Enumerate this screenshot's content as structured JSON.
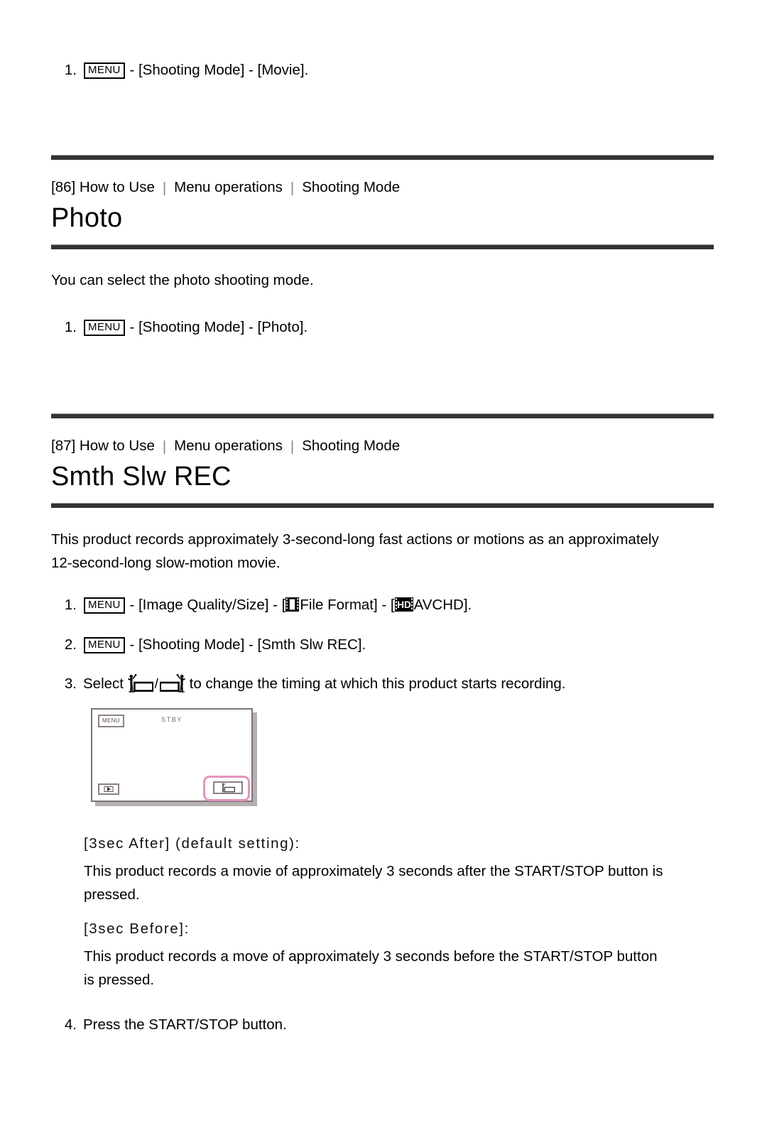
{
  "document": {
    "title": "Smth Slw REC"
  },
  "section_movie_step": {
    "number": "1.",
    "menu_label": "MENU",
    "text": " - [Shooting Mode] - [Movie]."
  },
  "section_photo": {
    "breadcrumb": {
      "item1": "[86] How to Use",
      "item2": "Menu operations",
      "item3": "Shooting Mode",
      "separator": "|"
    },
    "title": "Photo",
    "intro": "You can select the photo shooting mode.",
    "step": {
      "number": "1.",
      "menu_label": "MENU",
      "text": " - [Shooting Mode] - [Photo]."
    }
  },
  "section_smth_slw_rec": {
    "breadcrumb": {
      "item1": "[87] How to Use",
      "item2": "Menu operations",
      "item3": "Shooting Mode",
      "separator": "|"
    },
    "title": "Smth Slw REC",
    "intro_line1": "This product records approximately 3-second-long fast actions or motions as an approximately",
    "intro_line2": "12-second-long slow-motion movie.",
    "steps": [
      {
        "number": "1.",
        "menu_label": "MENU",
        "text_a": " - [Image Quality/Size] - [",
        "icon_a": "film-format-icon",
        "text_b": "File Format] - [",
        "icon_b": "hd-icon",
        "text_c": "AVCHD]."
      },
      {
        "number": "2.",
        "menu_label": "MENU",
        "text_a": " - [Shooting Mode] - [Smth Slw REC]."
      },
      {
        "number": "3.",
        "text_a": "Select ",
        "icon_a": "timing-after-icon",
        "separator": "/",
        "icon_b": "timing-before-icon",
        "text_b": " to change the timing at which this product starts recording."
      },
      {
        "number": "4.",
        "text_a": "Press the START/STOP button."
      }
    ],
    "lcd_figure": {
      "menu_label": "MENU",
      "status_label": "STBY",
      "playback_icon": "playback-icon",
      "timing_button_icon": "timing-after-icon",
      "highlight_color": "#e294bc"
    },
    "options": [
      {
        "heading": "[3sec After] (default setting):",
        "line1": "This product records a movie of approximately 3 seconds after the START/STOP button is",
        "line2": "pressed."
      },
      {
        "heading": "[3sec Before]:",
        "line1": "This product records a move of approximately 3 seconds before the START/STOP button",
        "line2": "is pressed."
      }
    ]
  },
  "colors": {
    "rule": "#333333",
    "highlight": "#e294bc",
    "text": "#000000"
  }
}
